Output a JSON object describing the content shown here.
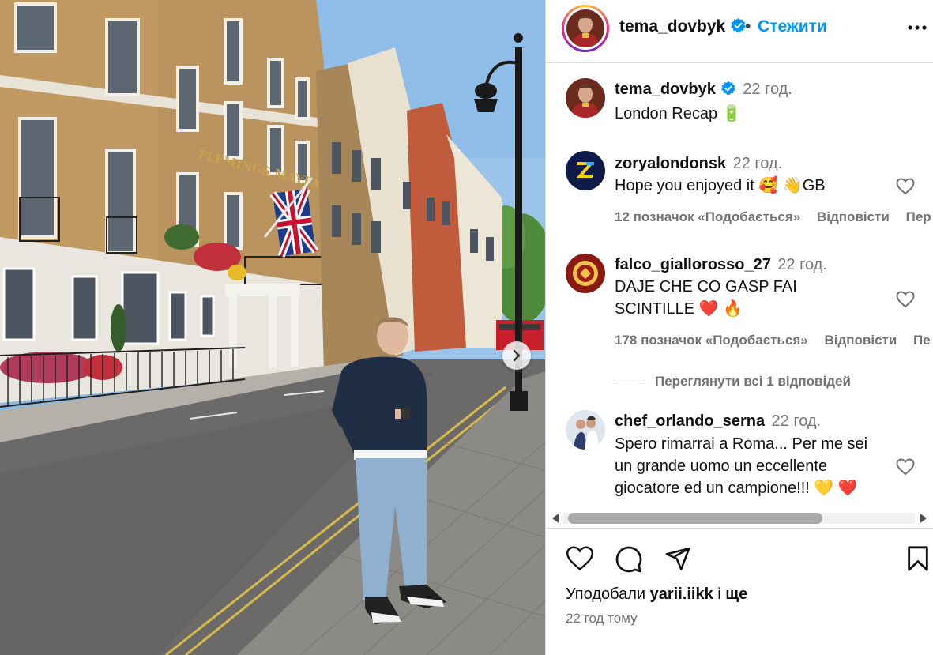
{
  "header": {
    "username": "tema_dovbyk",
    "separator": "•",
    "follow_label": "Стежити"
  },
  "caption": {
    "username": "tema_dovbyk",
    "time": "22 год.",
    "text": "London Recap 🔋"
  },
  "comments": [
    {
      "username": "zoryalondonsk",
      "time": "22 год.",
      "text": "Hope you enjoyed it 🥰 👋GB",
      "likes": "12 позначок «Подобається»",
      "reply": "Відповісти",
      "extra": "Пер"
    },
    {
      "username": "falco_giallorosso_27",
      "time": "22 год.",
      "text": "DAJE CHE CO GASP FAI SCINTILLE ❤️ 🔥",
      "likes": "178 позначок «Подобається»",
      "reply": "Відповісти",
      "extra": "Пе"
    },
    {
      "username": "chef_orlando_serna",
      "time": "22 год.",
      "text": "Spero rimarrai a Roma... Per me sei un grande uomo un eccellente giocatore ed un campione!!! 💛 ❤️"
    }
  ],
  "view_replies": "Переглянути всі 1 відповідей",
  "footer": {
    "liked_by_prefix": "Уподобали",
    "liked_by_user": "yarii.iikk",
    "liked_by_suffix": "і",
    "liked_by_more": "ще",
    "ago": "22 год тому"
  },
  "photo": {
    "hotel_sign": "FLEMINGS MAYFAIR"
  },
  "colors": {
    "accent": "#0095f6",
    "muted": "#737373",
    "border": "#dbdbdb",
    "heart_red": "#ed4956"
  },
  "icons": [
    "verified-badge-icon",
    "more-options-icon",
    "heart-icon",
    "comment-icon",
    "share-icon",
    "bookmark-icon",
    "chevron-right-icon"
  ]
}
